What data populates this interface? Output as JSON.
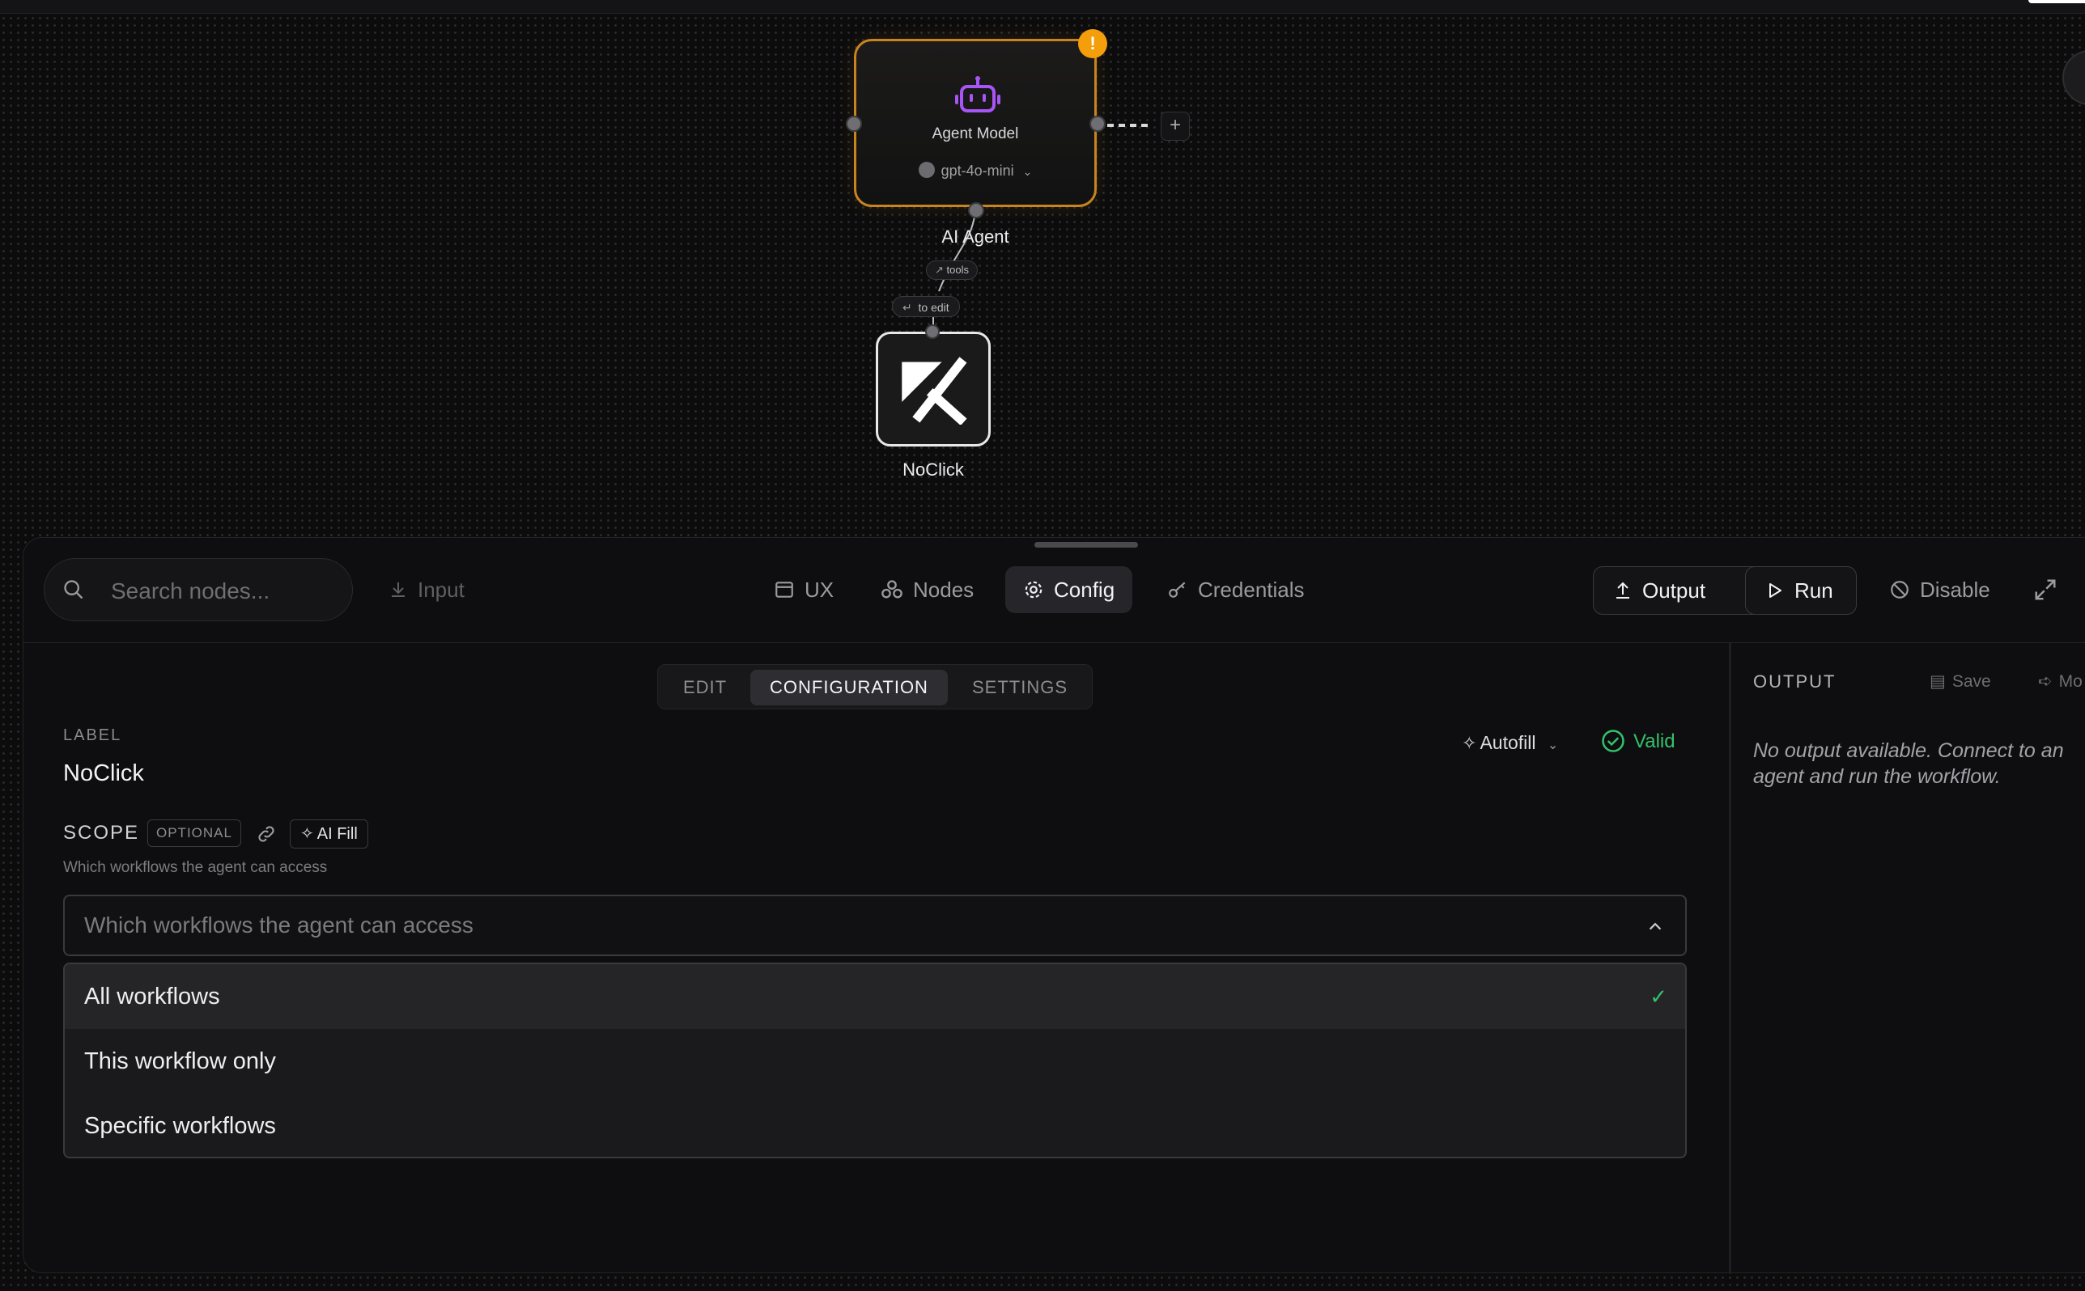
{
  "canvas": {
    "agent_node": {
      "title": "Agent Model",
      "model": "gpt-4o-mini",
      "warning": "!",
      "label": "AI Agent"
    },
    "add_button": "+",
    "tools_tag": "tools",
    "edit_hint": "to edit",
    "noclick_node": {
      "label": "NoClick"
    }
  },
  "toolbar": {
    "search_placeholder": "Search nodes...",
    "input": "Input",
    "tabs": [
      {
        "label": "UX"
      },
      {
        "label": "Nodes"
      },
      {
        "label": "Config"
      },
      {
        "label": "Credentials"
      }
    ],
    "output": "Output",
    "run": "Run",
    "disable": "Disable"
  },
  "config": {
    "subtabs": [
      "EDIT",
      "CONFIGURATION",
      "SETTINGS"
    ],
    "label_caption": "LABEL",
    "label_value": "NoClick",
    "autofill": "Autofill",
    "valid": "Valid",
    "scope": {
      "caption": "SCOPE",
      "badge": "OPTIONAL",
      "ai_fill": "AI Fill",
      "help": "Which workflows the agent can access",
      "placeholder": "Which workflows the agent can access",
      "options": [
        "All workflows",
        "This workflow only",
        "Specific workflows"
      ],
      "check": "✓"
    }
  },
  "output_panel": {
    "title": "OUTPUT",
    "save": "Save",
    "more": "Mo",
    "empty": "No output available. Connect to an agent and run the workflow."
  },
  "colors": {
    "accent_orange": "#c8851e",
    "warning": "#f59e0b",
    "agent_icon": "#a855f7",
    "valid_green": "#33c26b"
  }
}
